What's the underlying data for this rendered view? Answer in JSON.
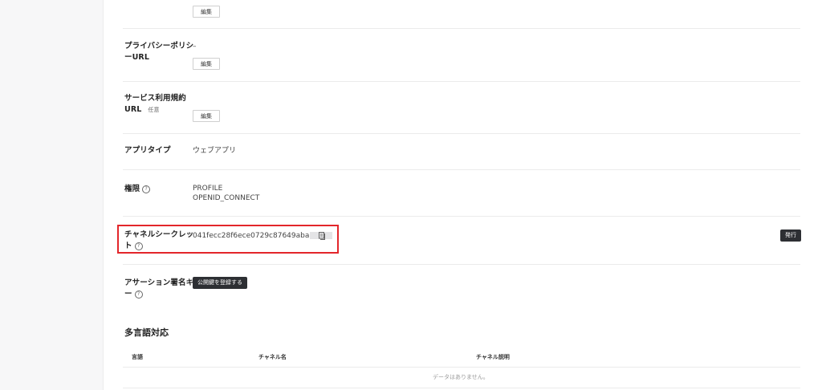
{
  "edit_label": "編集",
  "privacy_policy": {
    "label_line1": "プライバシーポリシ",
    "label_line2": "ーURL",
    "value": "–"
  },
  "terms": {
    "label_line1": "サービス利用規約",
    "label_line2": "URL",
    "optional": "任意"
  },
  "app_type": {
    "label": "アプリタイプ",
    "value": "ウェブアプリ"
  },
  "permissions": {
    "label": "権限",
    "help": "?",
    "values": [
      "PROFILE",
      "OPENID_CONNECT"
    ]
  },
  "channel_secret": {
    "label_line1": "チャネルシークレッ",
    "label_line2": "ト",
    "help": "?",
    "value": "041fecc28f6ece0729c87649aba",
    "issue_button": "発行"
  },
  "assertion_key": {
    "label_line1": "アサーション署名キ",
    "label_line2": "ー",
    "help": "?",
    "button": "公開鍵を登録する"
  },
  "multilang": {
    "title": "多言語対応",
    "columns": [
      "言語",
      "チャネル名",
      "チャネル説明"
    ],
    "empty_message": "データはありません。"
  },
  "colors": {
    "highlight": "#e3262b",
    "dark_button": "#2d2f33"
  }
}
